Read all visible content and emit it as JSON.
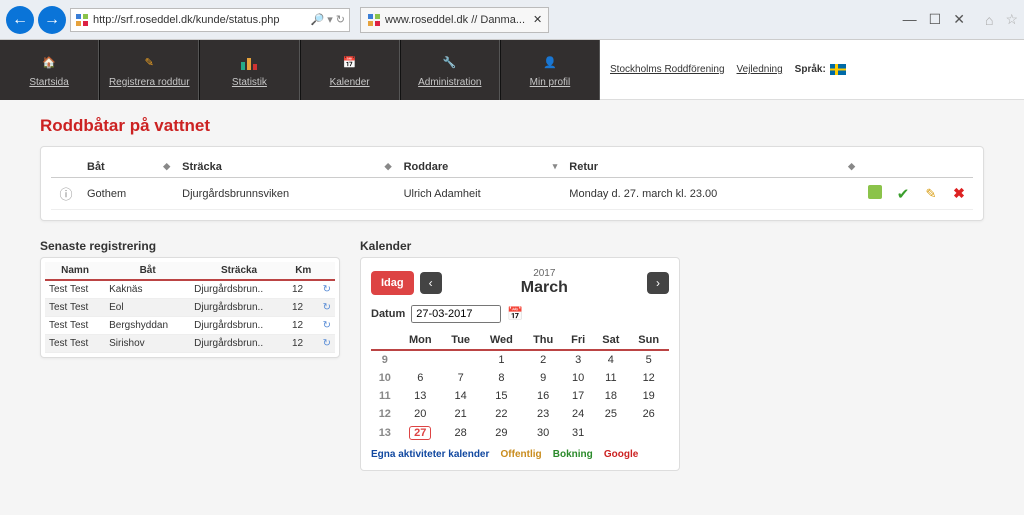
{
  "browser": {
    "url": "http://srf.roseddel.dk/kunde/status.php",
    "search_hint": "",
    "tab_title": "www.roseddel.dk // Danma...",
    "close": "✕"
  },
  "nav": {
    "startsida": "Startsida",
    "registrera": "Registrera roddtur",
    "statistik": "Statistik",
    "kalender": "Kalender",
    "admin": "Administration",
    "profil": "Min profil"
  },
  "topright": {
    "club": "Stockholms Roddförening",
    "veil": "Vejledning",
    "sprak": "Språk:"
  },
  "page_title": "Roddbåtar på vattnet",
  "boats": {
    "headers": {
      "boat": "Båt",
      "stracka": "Sträcka",
      "roddare": "Roddare",
      "retur": "Retur"
    },
    "rows": [
      {
        "boat": "Gothem",
        "stracka": "Djurgårdsbrunnsviken",
        "roddare": "Ulrich Adamheit",
        "retur": "Monday d. 27. march kl. 23.00"
      }
    ]
  },
  "recent": {
    "title": "Senaste registrering",
    "headers": {
      "namn": "Namn",
      "bat": "Båt",
      "stracka": "Sträcka",
      "km": "Km"
    },
    "rows": [
      {
        "namn": "Test Test",
        "bat": "Kaknäs",
        "stracka": "Djurgårdsbrun..",
        "km": "12"
      },
      {
        "namn": "Test Test",
        "bat": "Eol",
        "stracka": "Djurgårdsbrun..",
        "km": "12"
      },
      {
        "namn": "Test Test",
        "bat": "Bergshyddan",
        "stracka": "Djurgårdsbrun..",
        "km": "12"
      },
      {
        "namn": "Test Test",
        "bat": "Sirishov",
        "stracka": "Djurgårdsbrun..",
        "km": "12"
      }
    ]
  },
  "calendar": {
    "title": "Kalender",
    "idag": "Idag",
    "year": "2017",
    "month": "March",
    "datum_label": "Datum",
    "datum_value": "27-03-2017",
    "days": {
      "mon": "Mon",
      "tue": "Tue",
      "wed": "Wed",
      "thu": "Thu",
      "fri": "Fri",
      "sat": "Sat",
      "sun": "Sun"
    },
    "weeks": [
      {
        "wk": "9",
        "d": [
          "",
          "",
          "1",
          "2",
          "3",
          "4",
          "5"
        ]
      },
      {
        "wk": "10",
        "d": [
          "6",
          "7",
          "8",
          "9",
          "10",
          "11",
          "12"
        ]
      },
      {
        "wk": "11",
        "d": [
          "13",
          "14",
          "15",
          "16",
          "17",
          "18",
          "19"
        ]
      },
      {
        "wk": "12",
        "d": [
          "20",
          "21",
          "22",
          "23",
          "24",
          "25",
          "26"
        ]
      },
      {
        "wk": "13",
        "d": [
          "27",
          "28",
          "29",
          "30",
          "31",
          "",
          ""
        ]
      }
    ],
    "today_cell": "27",
    "legend": {
      "own": "Egna aktiviteter kalender",
      "off": "Offentlig",
      "bok": "Bokning",
      "goo": "Google"
    }
  }
}
